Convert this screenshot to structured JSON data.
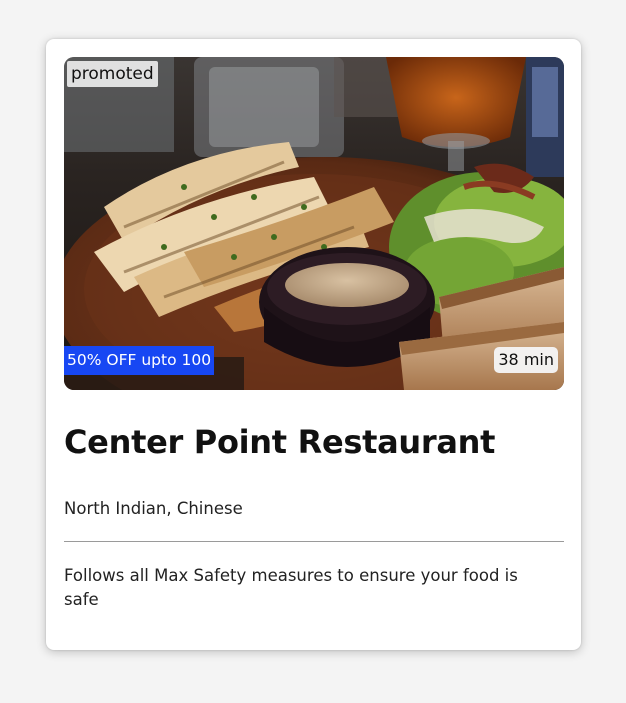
{
  "card": {
    "promoted_label": "promoted",
    "offer_text": "50% OFF upto 100",
    "delivery_time": "38 min",
    "restaurant_name": "Center Point Restaurant",
    "cuisines": "North Indian, Chinese",
    "safety_note": "Follows all Max Safety measures to ensure your food is safe"
  },
  "colors": {
    "offer_badge": "#1747f3",
    "card_background": "#ffffff",
    "page_background": "#f4f4f4"
  }
}
